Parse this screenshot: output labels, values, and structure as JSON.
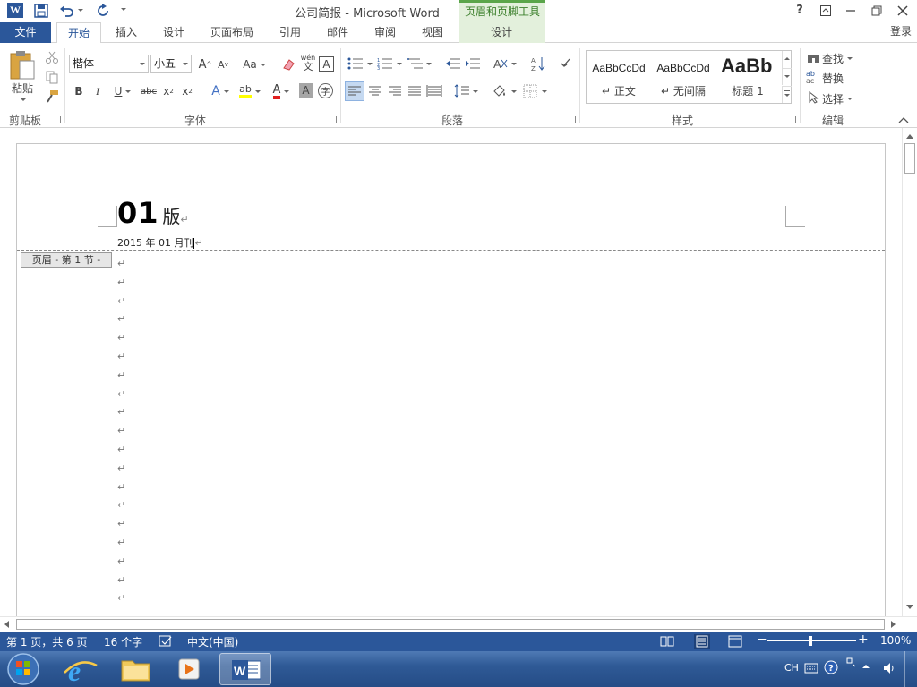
{
  "title_bar": {
    "title": "公司简报 - Microsoft Word",
    "context_tools": "页眉和页脚工具",
    "help": "?",
    "login": "登录"
  },
  "tabs": [
    {
      "label": "文件"
    },
    {
      "label": "开始"
    },
    {
      "label": "插入"
    },
    {
      "label": "设计"
    },
    {
      "label": "页面布局"
    },
    {
      "label": "引用"
    },
    {
      "label": "邮件"
    },
    {
      "label": "审阅"
    },
    {
      "label": "视图"
    },
    {
      "label": "设计"
    }
  ],
  "ribbon": {
    "clipboard": {
      "paste": "粘贴",
      "label": "剪贴板"
    },
    "font": {
      "name": "楷体",
      "size": "小五",
      "grow": "A",
      "shrink": "A",
      "case": "Aa",
      "pinyin": "wén",
      "pinyin_char": "文",
      "border_char": "A",
      "bold": "B",
      "italic": "I",
      "underline": "U",
      "strike": "abc",
      "sub": "x",
      "sup": "x",
      "effects": "A",
      "highlight": "ab",
      "color": "A",
      "shading": "A",
      "enclose": "字",
      "label": "字体"
    },
    "paragraph": {
      "label": "段落"
    },
    "styles": {
      "items": [
        {
          "sample": "AaBbCcDd",
          "name": "正文"
        },
        {
          "sample": "AaBbCcDd",
          "name": "无间隔"
        },
        {
          "sample": "AaBb",
          "name": "标题 1"
        }
      ],
      "label": "样式"
    },
    "editing": {
      "find": "查找",
      "replace": "替换",
      "select": "选择",
      "label": "编辑"
    }
  },
  "document": {
    "header_title_num": "01",
    "header_title_suffix": "版",
    "header_date": "2015 年 01 月刊",
    "header_tag": "页眉 - 第 1 节 -",
    "para_mark": "↵",
    "empty_paragraph_count": 19
  },
  "status": {
    "page": "第 1 页，共 6 页",
    "words": "16 个字",
    "language": "中文(中国)",
    "zoom": "100%"
  },
  "taskbar": {
    "ime": "CH"
  }
}
